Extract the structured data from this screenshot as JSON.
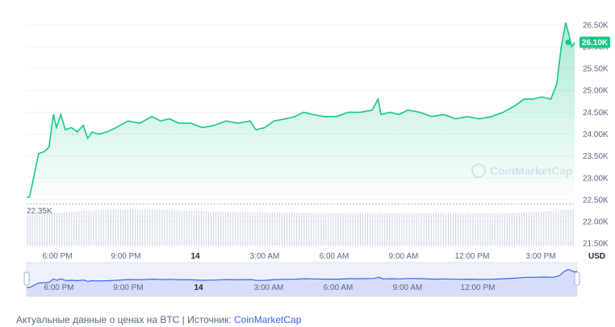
{
  "chart_data": {
    "type": "area",
    "title": "",
    "currency": "USD",
    "current_price_label": "26.10K",
    "start_price_label": "22.35K",
    "watermark": "CoinMarketCap",
    "y_ticks": [
      "26.50K",
      "26.00K",
      "25.50K",
      "25.00K",
      "24.50K",
      "24.00K",
      "23.50K",
      "23.00K",
      "22.50K",
      "22.00K",
      "21.50K"
    ],
    "ylim": [
      21300,
      26700
    ],
    "x_ticks": [
      "6:00 PM",
      "9:00 PM",
      "14",
      "3:00 AM",
      "6:00 AM",
      "9:00 AM",
      "12:00 PM",
      "3:00 PM"
    ],
    "nav_ticks": [
      "6:00 PM",
      "9:00 PM",
      "14",
      "3:00 AM",
      "6:00 AM",
      "9:00 AM",
      "12:00 PM"
    ],
    "line_color": "#16c784",
    "price_series": [
      [
        0.0,
        22550
      ],
      [
        0.1,
        22560
      ],
      [
        0.25,
        23050
      ],
      [
        0.4,
        23550
      ],
      [
        0.6,
        23600
      ],
      [
        0.75,
        23700
      ],
      [
        0.9,
        24450
      ],
      [
        1.0,
        24150
      ],
      [
        1.15,
        24450
      ],
      [
        1.3,
        24100
      ],
      [
        1.5,
        24150
      ],
      [
        1.7,
        24050
      ],
      [
        1.9,
        24200
      ],
      [
        2.05,
        23900
      ],
      [
        2.2,
        24050
      ],
      [
        2.4,
        24000
      ],
      [
        2.7,
        24050
      ],
      [
        3.0,
        24150
      ],
      [
        3.4,
        24300
      ],
      [
        3.8,
        24250
      ],
      [
        4.2,
        24400
      ],
      [
        4.5,
        24300
      ],
      [
        4.8,
        24350
      ],
      [
        5.1,
        24250
      ],
      [
        5.5,
        24250
      ],
      [
        5.9,
        24150
      ],
      [
        6.3,
        24200
      ],
      [
        6.7,
        24300
      ],
      [
        7.1,
        24250
      ],
      [
        7.5,
        24300
      ],
      [
        7.7,
        24100
      ],
      [
        8.0,
        24150
      ],
      [
        8.3,
        24300
      ],
      [
        8.7,
        24350
      ],
      [
        9.0,
        24400
      ],
      [
        9.3,
        24500
      ],
      [
        9.6,
        24450
      ],
      [
        10.0,
        24400
      ],
      [
        10.4,
        24400
      ],
      [
        10.8,
        24500
      ],
      [
        11.2,
        24500
      ],
      [
        11.6,
        24550
      ],
      [
        11.8,
        24800
      ],
      [
        11.9,
        24450
      ],
      [
        12.2,
        24500
      ],
      [
        12.5,
        24450
      ],
      [
        12.8,
        24550
      ],
      [
        13.2,
        24500
      ],
      [
        13.6,
        24400
      ],
      [
        14.0,
        24450
      ],
      [
        14.4,
        24350
      ],
      [
        14.8,
        24400
      ],
      [
        15.2,
        24350
      ],
      [
        15.6,
        24400
      ],
      [
        16.0,
        24500
      ],
      [
        16.4,
        24650
      ],
      [
        16.7,
        24800
      ],
      [
        17.0,
        24800
      ],
      [
        17.3,
        24850
      ],
      [
        17.6,
        24800
      ],
      [
        17.8,
        25150
      ],
      [
        17.95,
        26000
      ],
      [
        18.1,
        26550
      ],
      [
        18.2,
        26300
      ],
      [
        18.3,
        26000
      ],
      [
        18.4,
        26100
      ]
    ],
    "volume_series": [
      [
        0,
        0.82
      ],
      [
        1,
        0.86
      ],
      [
        2,
        0.92
      ],
      [
        3,
        0.95
      ],
      [
        4,
        0.95
      ],
      [
        5,
        0.93
      ],
      [
        6,
        0.91
      ],
      [
        7,
        0.89
      ],
      [
        8,
        0.88
      ],
      [
        9,
        0.87
      ],
      [
        10,
        0.86
      ],
      [
        11,
        0.86
      ],
      [
        12,
        0.86
      ],
      [
        13,
        0.86
      ],
      [
        14,
        0.86
      ],
      [
        15,
        0.86
      ],
      [
        16,
        0.86
      ],
      [
        17,
        0.88
      ],
      [
        18,
        0.94
      ],
      [
        18.4,
        0.96
      ]
    ],
    "x_range_hours": [
      0,
      18.4
    ]
  },
  "footer": {
    "caption_text": "Актуальные данные о ценах на BTC | Источник: ",
    "caption_source": "CoinMarketCap"
  }
}
